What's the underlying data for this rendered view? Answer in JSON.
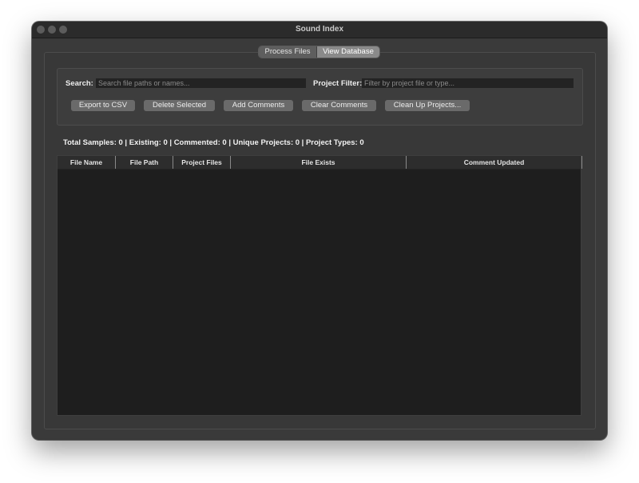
{
  "window": {
    "title": "Sound Index"
  },
  "tabs": [
    {
      "label": "Process Files",
      "active": false
    },
    {
      "label": "View Database",
      "active": true
    }
  ],
  "filters": {
    "search_label": "Search:",
    "search_placeholder": "Search file paths or names...",
    "search_value": "",
    "project_filter_label": "Project Filter:",
    "project_filter_placeholder": "Filter by project file or type...",
    "project_filter_value": ""
  },
  "actions": {
    "export_csv": "Export to CSV",
    "delete_selected": "Delete Selected",
    "add_comments": "Add Comments",
    "clear_comments": "Clear Comments",
    "clean_up_projects": "Clean Up Projects..."
  },
  "stats": {
    "summary": "Total Samples: 0 | Existing: 0 | Commented: 0 | Unique Projects: 0 | Project Types: 0"
  },
  "table": {
    "columns": [
      "File Name",
      "File Path",
      "Project Files",
      "File Exists",
      "Comment Updated"
    ],
    "rows": []
  },
  "colors": {
    "window_bg": "#3a3a3a",
    "titlebar_bg": "#2b2b2b",
    "table_bg": "#1e1e1e",
    "button_bg": "#6a6a6a",
    "active_tab_bg": "#8a8a8a"
  }
}
